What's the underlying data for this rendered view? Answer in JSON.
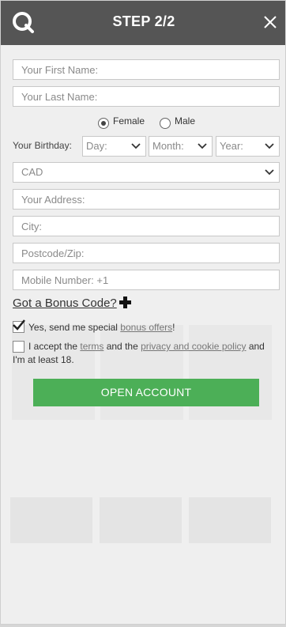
{
  "header": {
    "title": "STEP 2/2"
  },
  "form": {
    "first_name_placeholder": "Your First Name:",
    "last_name_placeholder": "Your Last Name:",
    "gender": {
      "female": "Female",
      "male": "Male",
      "selected": "Female"
    },
    "birthday": {
      "label": "Your Birthday:",
      "day": "Day:",
      "month": "Month:",
      "year": "Year:"
    },
    "currency": "CAD",
    "address_placeholder": "Your Address:",
    "city_placeholder": "City:",
    "postcode_placeholder": "Postcode/Zip:",
    "mobile_placeholder": "Mobile Number: +1"
  },
  "bonus_code_link": "Got a Bonus Code?",
  "offers": {
    "prefix": "Yes, send me special ",
    "link": "bonus offers",
    "suffix": "!",
    "checked": true
  },
  "terms": {
    "prefix": "I accept the ",
    "terms_link": "terms",
    "middle": " and the ",
    "privacy_link": "privacy and cookie policy",
    "suffix": " and I'm at least 18.",
    "checked": false
  },
  "submit_label": "OPEN ACCOUNT",
  "colors": {
    "header": "#555555",
    "button": "#4caf57",
    "background": "#efefef"
  }
}
